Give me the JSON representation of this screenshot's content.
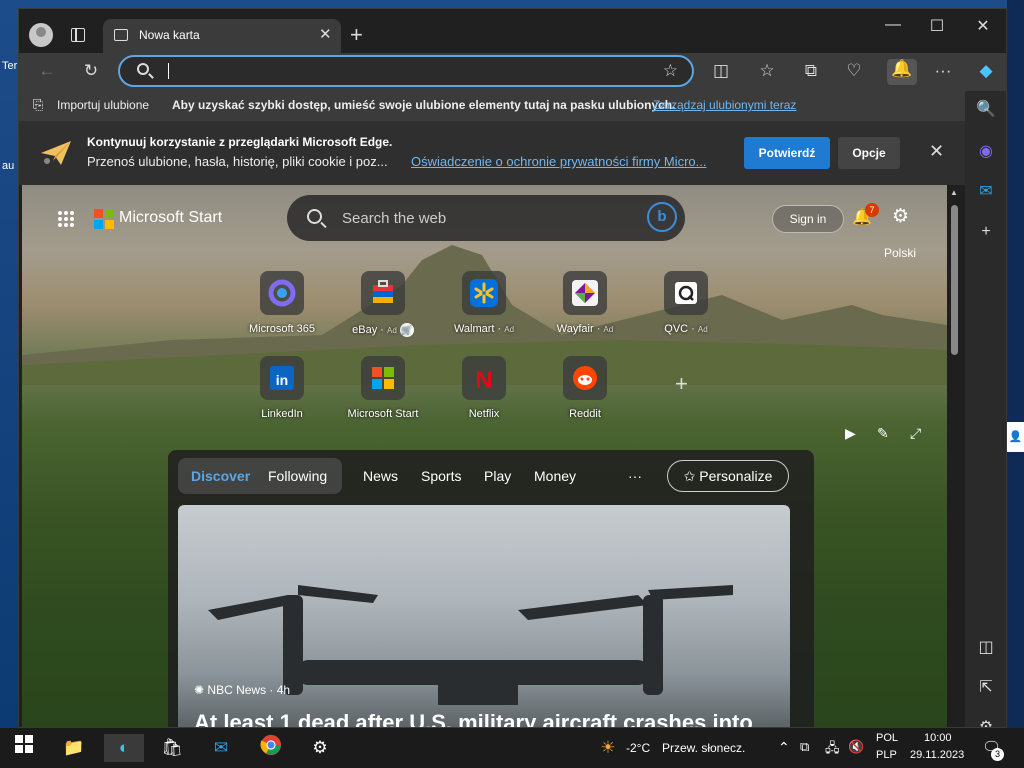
{
  "desktop": {
    "label1": "Ter",
    "label2": "au"
  },
  "tab": {
    "title": "Nowa karta"
  },
  "address": {
    "placeholder": "",
    "value": ""
  },
  "favorites_bar": {
    "import_label": "Importuj ulubione",
    "message": "Aby uzyskać szybki dostęp, umieść swoje ulubione elementy tutaj na pasku ulubionych.",
    "manage_link": "Zarządzaj ulubionymi teraz"
  },
  "infobar": {
    "title": "Kontynuuj korzystanie z przeglądarki Microsoft Edge.",
    "text": "Przenoś ulubione, hasła, historię, pliki cookie i poz...",
    "privacy_link": "Oświadczenie o ochronie prywatności firmy Micro...",
    "confirm": "Potwierdź",
    "options": "Opcje"
  },
  "start": {
    "brand": "Microsoft Start",
    "search_placeholder": "Search the web",
    "sign_in": "Sign in",
    "notif_count": "7",
    "language": "Polski",
    "tiles_row1": [
      {
        "label": "Microsoft 365",
        "ad": ""
      },
      {
        "label": "eBay",
        "ad": "Ad"
      },
      {
        "label": "Walmart",
        "ad": "Ad"
      },
      {
        "label": "Wayfair",
        "ad": "Ad"
      },
      {
        "label": "QVC",
        "ad": "Ad"
      }
    ],
    "tiles_row2": [
      {
        "label": "LinkedIn"
      },
      {
        "label": "Microsoft Start"
      },
      {
        "label": "Netflix"
      },
      {
        "label": "Reddit"
      }
    ],
    "nav": {
      "discover": "Discover",
      "following": "Following",
      "news": "News",
      "sports": "Sports",
      "play": "Play",
      "money": "Money",
      "more": "···",
      "personalize": "Personalize"
    },
    "article": {
      "source": "NBC News · 4h",
      "title": "At least 1 dead after U.S. military aircraft crashes into"
    }
  },
  "taskbar": {
    "weather_temp": "-2°C",
    "weather_text": "Przew. słonecz.",
    "lang_top": "POL",
    "lang_bottom": "PLP",
    "time": "10:00",
    "date": "29.11.2023",
    "notif_count": "3"
  },
  "colors": {
    "accent": "#1f7ad1",
    "link": "#6fb7f2",
    "badge": "#d83b01"
  }
}
